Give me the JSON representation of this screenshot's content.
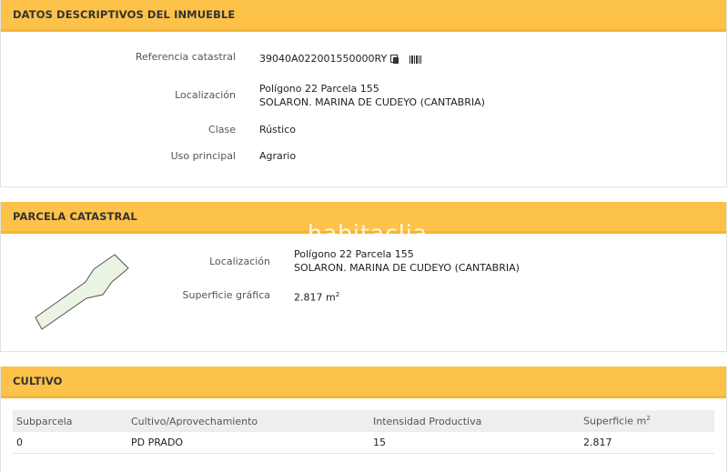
{
  "panel1": {
    "title": "DATOS DESCRIPTIVOS DEL INMUEBLE",
    "ref_label": "Referencia catastral",
    "ref_value": "39040A022001550000RY",
    "loc_label": "Localización",
    "loc_line1": "Polígono 22 Parcela 155",
    "loc_line2": "SOLARON. MARINA DE CUDEYO (CANTABRIA)",
    "clase_label": "Clase",
    "clase_value": "Rústico",
    "uso_label": "Uso principal",
    "uso_value": "Agrario"
  },
  "panel2": {
    "title": "PARCELA CATASTRAL",
    "loc_label": "Localización",
    "loc_line1": "Polígono 22 Parcela 155",
    "loc_line2": "SOLARON. MARINA DE CUDEYO (CANTABRIA)",
    "sup_label": "Superficie gráfica",
    "sup_value": "2.817 m",
    "sup_exp": "2"
  },
  "panel3": {
    "title": "CULTIVO",
    "headers": [
      "Subparcela",
      "Cultivo/Aprovechamiento",
      "Intensidad Productiva",
      "Superficie m"
    ],
    "header_exp": "2",
    "row": [
      "0",
      "PD PRADO",
      "15",
      "2.817"
    ]
  },
  "watermark": "habitaclia",
  "icons": {
    "copy": "copy-icon",
    "barcode": "barcode-icon"
  }
}
